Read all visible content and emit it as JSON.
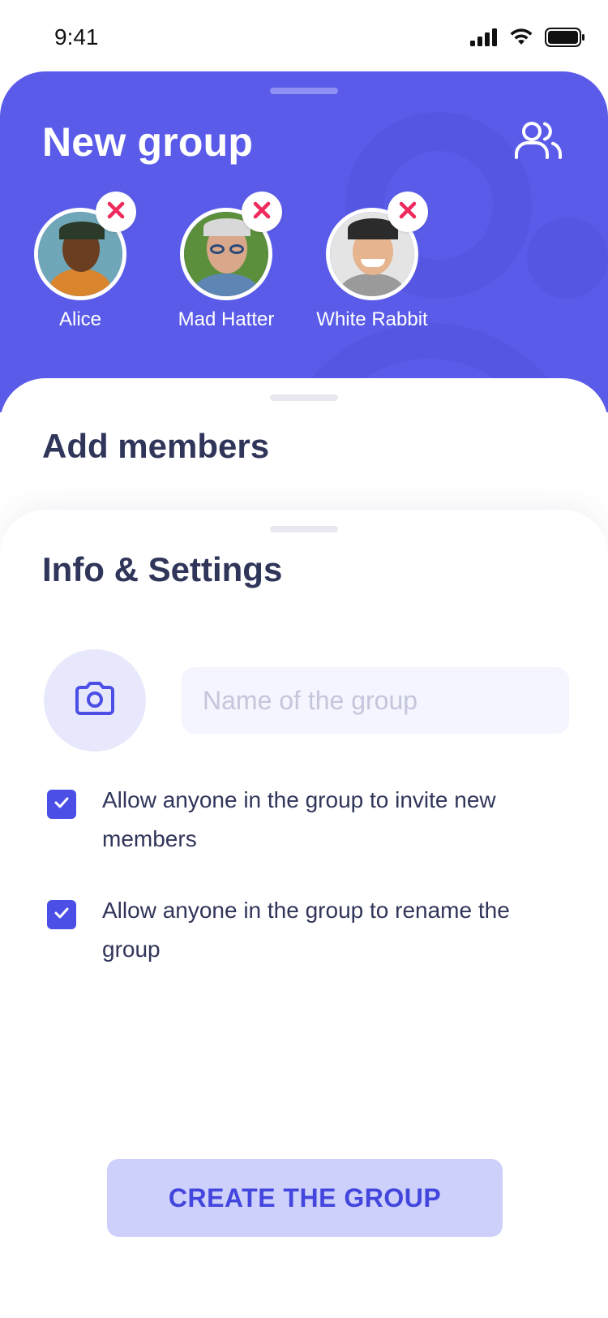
{
  "status_bar": {
    "time": "9:41"
  },
  "header": {
    "title": "New group",
    "people_icon": "users-icon"
  },
  "members": [
    {
      "name": "Alice",
      "remove_icon": "close-icon",
      "skin": "#6b3e22",
      "bg": "#6fa7b8",
      "shirt": "#d9852e",
      "hair": "#2c3a2a"
    },
    {
      "name": "Mad Hatter",
      "remove_icon": "close-icon",
      "skin": "#d9a88a",
      "bg": "#5c8f3c",
      "shirt": "#5d86b5",
      "hair": "#d8d8d8"
    },
    {
      "name": "White Rabbit",
      "remove_icon": "close-icon",
      "skin": "#e6b48e",
      "bg": "#e4e4e4",
      "shirt": "#9a9a9a",
      "hair": "#2b2b2b"
    }
  ],
  "add_members": {
    "title": "Add members"
  },
  "info": {
    "title": "Info & Settings",
    "camera_icon": "camera-icon",
    "name_placeholder": "Name of the group",
    "name_value": "",
    "options": [
      {
        "label": "Allow anyone in the group to invite new members",
        "checked": true
      },
      {
        "label": "Allow anyone in the group to rename the group",
        "checked": true
      }
    ],
    "create_label": "CREATE THE GROUP"
  },
  "colors": {
    "primary": "#5a5ce9",
    "accent": "#4b4fe6",
    "remove": "#ee2a5c",
    "button_bg": "#cdd0fb",
    "text_dark": "#30355a"
  }
}
